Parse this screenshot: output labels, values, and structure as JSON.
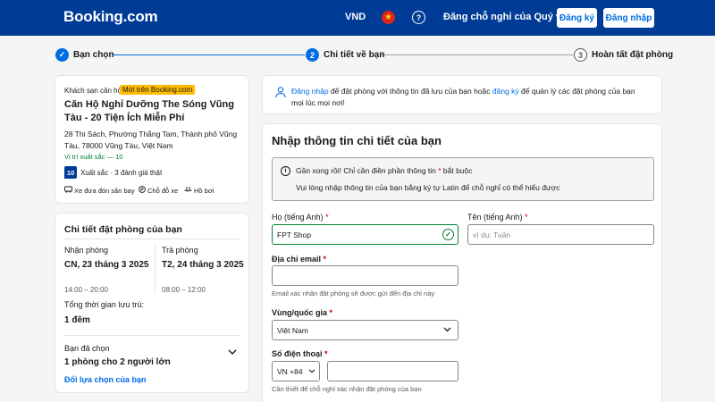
{
  "header": {
    "logo": "Booking.com",
    "currency": "VND",
    "flag_icon": "vietnam-flag-icon",
    "help_icon": "question-icon",
    "list_property": "Đăng chỗ nghỉ của Quý vị",
    "register": "Đăng ký",
    "login": "Đăng nhập"
  },
  "steps": [
    {
      "number": "✓",
      "label": "Bạn chọn",
      "state": "done"
    },
    {
      "number": "2",
      "label": "Chi tiết về bạn",
      "state": "current"
    },
    {
      "number": "3",
      "label": "Hoàn tất đặt phòng",
      "state": "upcoming"
    }
  ],
  "hotel": {
    "type": "Khách sạn căn hộ",
    "badge": "Mới trên Booking.com",
    "name": "Căn Hộ Nghỉ Dưỡng The Sóng Vũng Tàu - 20 Tiện Ích Miễn Phí",
    "address": "28 Thi Sách, Phường Thắng Tam, Thành phố Vũng Tàu, 78000 Vũng Tàu, Việt Nam",
    "location_score": "Vị trí xuất sắc — 10",
    "score": "10",
    "score_text": "Xuất sắc · 3 đánh giá thật",
    "amenities": [
      {
        "icon": "shuttle-icon",
        "label": "Xe đưa đón sân bay"
      },
      {
        "icon": "parking-icon",
        "label": "Chỗ đỗ xe"
      },
      {
        "icon": "pool-icon",
        "label": "Hồ bơi"
      }
    ]
  },
  "booking": {
    "title": "Chi tiết đặt phòng của bạn",
    "checkin_label": "Nhận phòng",
    "checkin_date": "CN, 23 tháng 3 2025",
    "checkin_time": "14:00 – 20:00",
    "checkout_label": "Trả phòng",
    "checkout_date": "T2, 24 tháng 3 2025",
    "checkout_time": "08:00 – 12:00",
    "stay_label": "Tổng thời gian lưu trú:",
    "stay_value": "1 đêm",
    "selected_label": "Bạn đã chọn",
    "selected_value": "1 phòng cho 2 người lớn",
    "change_link": "Đổi lựa chọn của bạn"
  },
  "signin": {
    "link1": "Đăng nhập",
    "text1": " để đặt phòng với thông tin đã lưu của bạn hoặc ",
    "link2": "đăng ký",
    "text2": " để quản lý các đặt phòng của bạn mọi lúc mọi nơi!"
  },
  "form": {
    "title": "Nhập thông tin chi tiết của bạn",
    "info_line1_a": "Gần xong rồi! Chỉ cần điền phần thông tin ",
    "info_line1_star": "*",
    "info_line1_b": " bắt buộc",
    "info_line2": "Vui lòng nhập thông tin của bạn bằng ký tự Latin để chỗ nghỉ có thể hiểu được",
    "last_name_label": "Họ (tiếng Anh)",
    "last_name_value": "FPT Shop",
    "first_name_label": "Tên (tiếng Anh)",
    "first_name_placeholder": "ví dụ: Tuấn",
    "email_label": "Địa chỉ email",
    "email_value": "",
    "email_hint": "Email xác nhận đặt phòng sẽ được gửi đến địa chỉ này",
    "country_label": "Vùng/quốc gia",
    "country_value": "Việt Nam",
    "phone_label": "Số điện thoại",
    "phone_code": "VN +84",
    "phone_value": "",
    "phone_hint": "Cần thiết để chỗ nghỉ xác nhận đặt phòng của bạn",
    "required_mark": "*"
  },
  "colors": {
    "brand": "#003b95",
    "link": "#006ce4",
    "badge": "#febb02",
    "success": "#008234"
  }
}
